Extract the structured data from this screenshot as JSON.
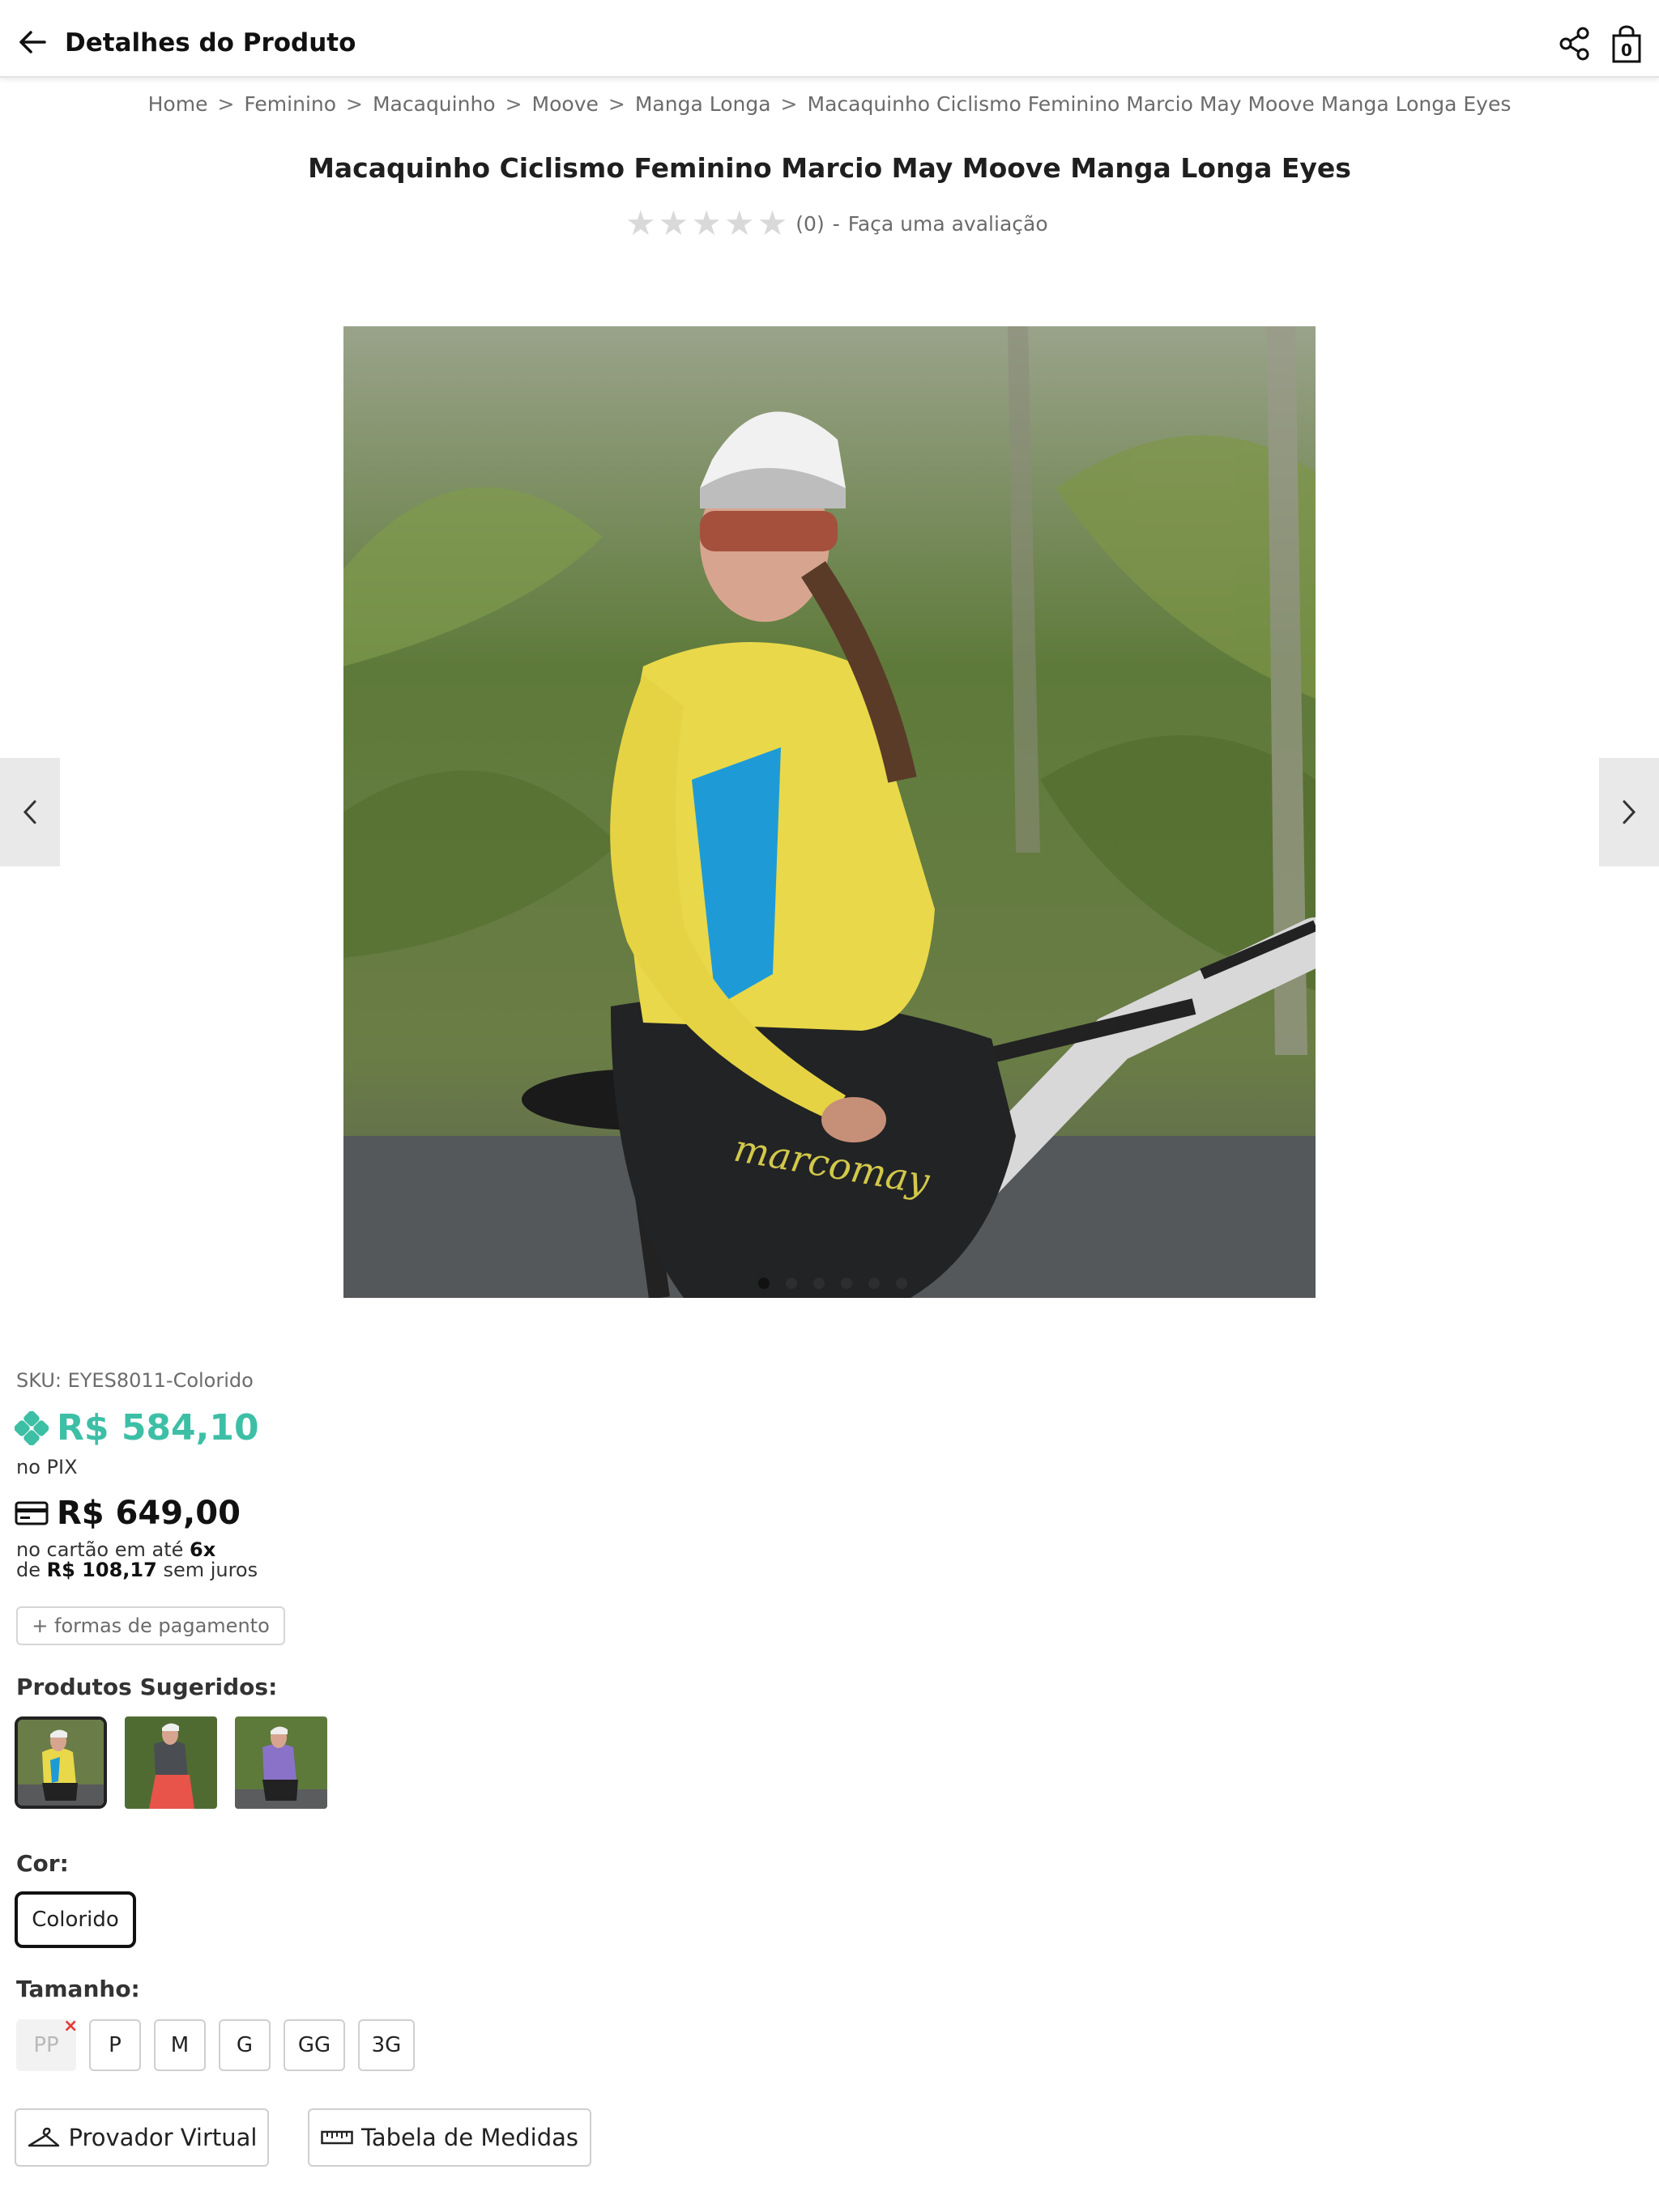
{
  "header": {
    "title": "Detalhes do Produto",
    "cart_count": "0"
  },
  "breadcrumb": [
    "Home",
    "Feminino",
    "Macaquinho",
    "Moove",
    "Manga Longa",
    "Macaquinho Ciclismo Feminino Marcio May Moove Manga Longa Eyes"
  ],
  "breadcrumb_separator": ">",
  "product": {
    "title": "Macaquinho Ciclismo Feminino Marcio May Moove Manga Longa Eyes",
    "rating_count": "(0)",
    "rating_dash": "-",
    "rating_cta": "Faça uma avaliação",
    "rating_stars": 0,
    "sku": "SKU: EYES8011-Colorido",
    "pix_price": "R$ 584,10",
    "pix_label": "no PIX",
    "card_price": "R$ 649,00",
    "installment_prefix": "no cartão em até",
    "installment_count": "6x",
    "installment_de": "de",
    "installment_value": "R$ 108,17",
    "installment_suffix": "sem juros",
    "payment_button": "+ formas de pagamento"
  },
  "gallery": {
    "image_count": 6,
    "active_index": 0
  },
  "suggested": {
    "label": "Produtos Sugeridos:",
    "items": [
      {
        "color": "yellow",
        "selected": true
      },
      {
        "color": "gray-red",
        "selected": false
      },
      {
        "color": "purple",
        "selected": false
      }
    ]
  },
  "color": {
    "label": "Cor:",
    "selected": "Colorido"
  },
  "size": {
    "label": "Tamanho:",
    "options": [
      "PP",
      "P",
      "M",
      "G",
      "GG",
      "3G"
    ],
    "unavailable": [
      "PP"
    ],
    "unavailable_mark": "×"
  },
  "tools": {
    "virtual_fitting": "Provador Virtual",
    "size_chart": "Tabela de Medidas"
  },
  "colors": {
    "pix_accent": "#3dbfa6",
    "jersey_yellow": "#e9d84a",
    "jersey_blue": "#1e9bd7",
    "unavailable_mark": "#e53935"
  }
}
